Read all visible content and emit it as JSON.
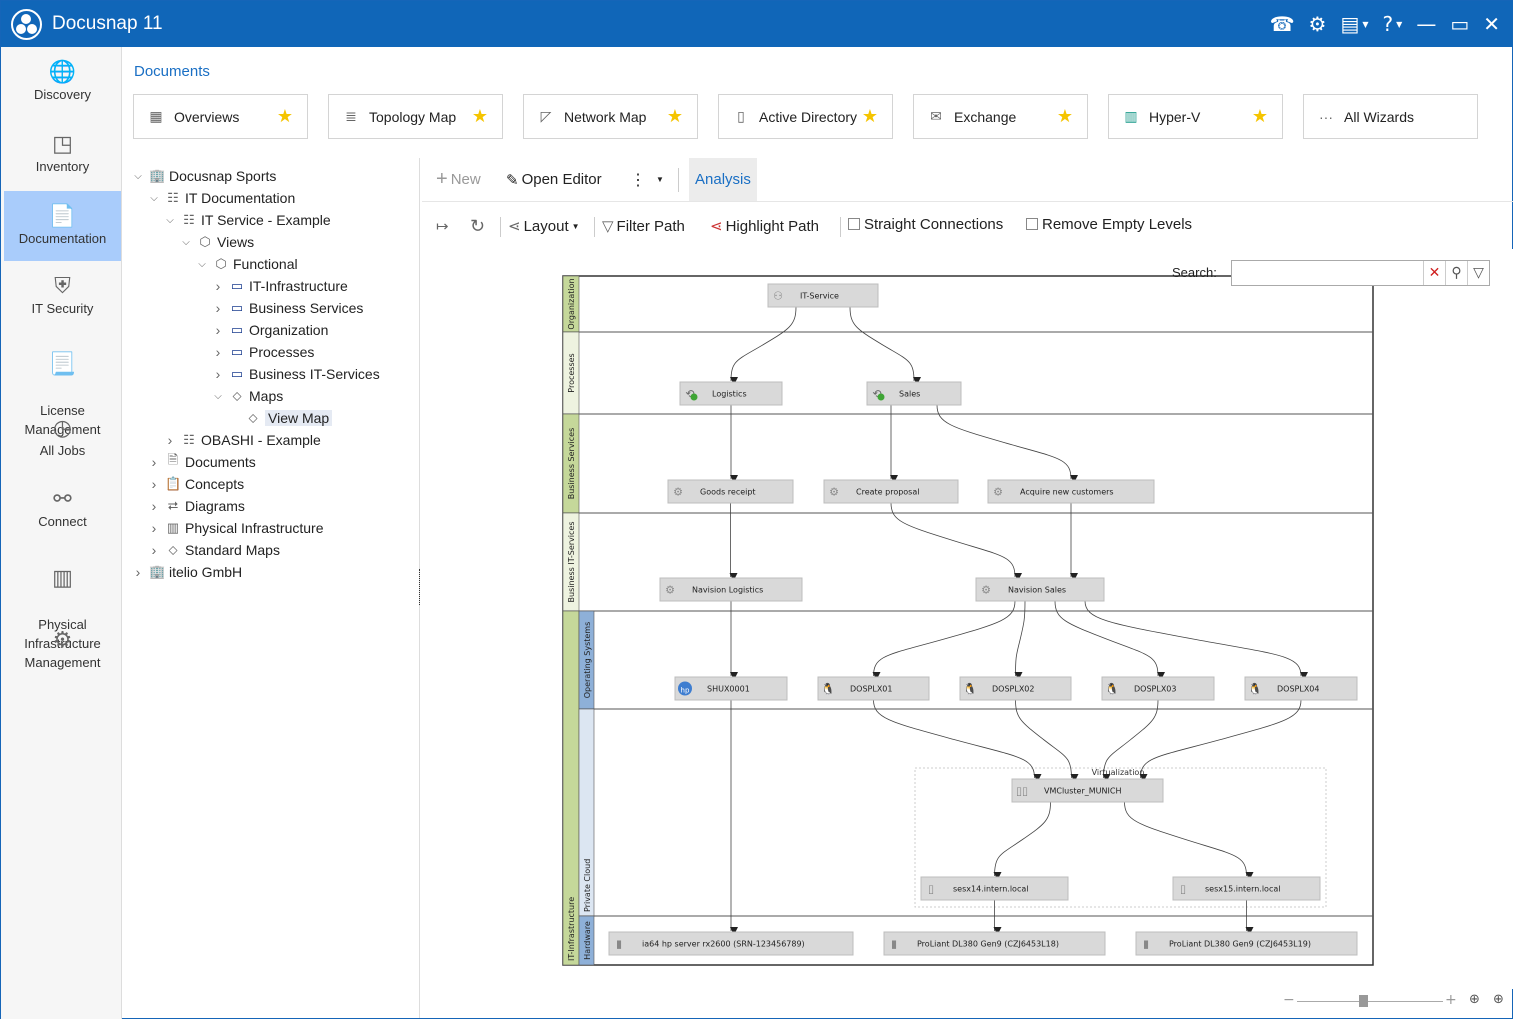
{
  "app": {
    "title": "Docusnap 11",
    "titlebar_icons": [
      {
        "name": "headset-icon",
        "glyph": "☎"
      },
      {
        "name": "gear-icon",
        "glyph": "⚙"
      },
      {
        "name": "workspace-icon",
        "glyph": "▤"
      },
      {
        "name": "help-icon",
        "glyph": "?"
      },
      {
        "name": "minimize-icon",
        "glyph": "—"
      },
      {
        "name": "maximize-icon",
        "glyph": "▭"
      },
      {
        "name": "close-icon",
        "glyph": "✕"
      }
    ]
  },
  "sidebar": {
    "items": [
      {
        "label": "Discovery",
        "icon": "🌐"
      },
      {
        "label": "Inventory",
        "icon": "◳"
      },
      {
        "label": "Documentation",
        "icon": "📄",
        "active": true
      },
      {
        "label": "IT Security",
        "icon": "⛨"
      },
      {
        "label": "License\nManagement",
        "icon": "📃"
      },
      {
        "label": "All Jobs",
        "icon": "◷"
      },
      {
        "label": "Connect",
        "icon": "⚯"
      },
      {
        "label": "Physical\nInfrastructure",
        "icon": "▥"
      },
      {
        "label": "Management",
        "icon": "⚙"
      }
    ]
  },
  "documents": {
    "header": "Documents",
    "wizards": [
      {
        "label": "Overviews",
        "icon": "▦",
        "starred": true
      },
      {
        "label": "Topology Map",
        "icon": "≣",
        "starred": true
      },
      {
        "label": "Network Map",
        "icon": "◸",
        "starred": true
      },
      {
        "label": "Active Directory",
        "icon": "▯",
        "starred": true
      },
      {
        "label": "Exchange",
        "icon": "✉",
        "starred": true
      },
      {
        "label": "Hyper-V",
        "icon": "▥",
        "starred": true
      },
      {
        "label": "All Wizards",
        "icon": "···",
        "starred": false
      }
    ],
    "star": "★"
  },
  "tree": {
    "nodes": [
      {
        "label": "Docusnap Sports",
        "level": 0,
        "expanded": true,
        "icon": "🏢"
      },
      {
        "label": "IT Documentation",
        "level": 1,
        "expanded": true,
        "icon": "☷"
      },
      {
        "label": "IT Service - Example",
        "level": 2,
        "expanded": true,
        "icon": "☷"
      },
      {
        "label": "Views",
        "level": 3,
        "expanded": true,
        "icon": "⬡"
      },
      {
        "label": "Functional",
        "level": 4,
        "expanded": true,
        "icon": "⬡"
      },
      {
        "label": "IT-Infrastructure",
        "level": 5,
        "expanded": false,
        "icon": "▭"
      },
      {
        "label": "Business Services",
        "level": 5,
        "expanded": false,
        "icon": "▭"
      },
      {
        "label": "Organization",
        "level": 5,
        "expanded": false,
        "icon": "▭"
      },
      {
        "label": "Processes",
        "level": 5,
        "expanded": false,
        "icon": "▭"
      },
      {
        "label": "Business IT-Services",
        "level": 5,
        "expanded": false,
        "icon": "▭"
      },
      {
        "label": "Maps",
        "level": 5,
        "expanded": true,
        "icon": "⬦"
      },
      {
        "label": "View Map",
        "level": 6,
        "leaf": true,
        "selected": true,
        "icon": "⬦"
      },
      {
        "label": "OBASHI - Example",
        "level": 2,
        "expanded": false,
        "icon": "☷"
      },
      {
        "label": "Documents",
        "level": 1,
        "expanded": false,
        "icon": "🗎"
      },
      {
        "label": "Concepts",
        "level": 1,
        "expanded": false,
        "icon": "📋"
      },
      {
        "label": "Diagrams",
        "level": 1,
        "expanded": false,
        "icon": "⮂"
      },
      {
        "label": "Physical Infrastructure",
        "level": 1,
        "expanded": false,
        "icon": "▥"
      },
      {
        "label": "Standard Maps",
        "level": 1,
        "expanded": false,
        "icon": "⬦"
      },
      {
        "label": "itelio GmbH",
        "level": 0,
        "expanded": false,
        "icon": "🏢"
      }
    ]
  },
  "toolbar": {
    "new_label": "New",
    "open_editor_label": "Open Editor",
    "analysis_tab": "Analysis",
    "layout_label": "Layout",
    "filter_path_label": "Filter Path",
    "highlight_path_label": "Highlight Path",
    "straight_connections_label": "Straight Connections",
    "straight_connections_checked": false,
    "remove_empty_levels_label": "Remove Empty Levels",
    "remove_empty_levels_checked": false
  },
  "search": {
    "label": "Search:",
    "value": "",
    "placeholder": ""
  },
  "map": {
    "lanes": [
      {
        "label": "Organization",
        "color": "#c5d89a"
      },
      {
        "label": "Processes",
        "color": "#eef3e0"
      },
      {
        "label": "Business Services",
        "color": "#c5d89a"
      },
      {
        "label": "Business IT-Services",
        "color": "#eef3e0"
      }
    ],
    "infra_lane": {
      "label": "IT-Infrastructure",
      "color": "#c5d89a"
    },
    "sub_lanes": [
      {
        "label": "Operating Systems",
        "color": "#8eb0d8"
      },
      {
        "label": "Private Cloud",
        "color": "#dce6f2"
      },
      {
        "label": "Hardware",
        "color": "#8eb0d8"
      }
    ],
    "group_label": "Virtualization",
    "nodes": [
      {
        "id": "itservice",
        "label": "IT-Service",
        "icon": "org"
      },
      {
        "id": "logistics",
        "label": "Logistics",
        "icon": "process"
      },
      {
        "id": "sales",
        "label": "Sales",
        "icon": "process"
      },
      {
        "id": "goods",
        "label": "Goods receipt",
        "icon": "gear"
      },
      {
        "id": "proposal",
        "label": "Create proposal",
        "icon": "gear"
      },
      {
        "id": "acquire",
        "label": "Acquire new customers",
        "icon": "gear"
      },
      {
        "id": "navlog",
        "label": "Navision Logistics",
        "icon": "gear"
      },
      {
        "id": "navsales",
        "label": "Navision Sales",
        "icon": "gear"
      },
      {
        "id": "shux",
        "label": "SHUX0001",
        "icon": "hp"
      },
      {
        "id": "dos1",
        "label": "DOSPLX01",
        "icon": "linux"
      },
      {
        "id": "dos2",
        "label": "DOSPLX02",
        "icon": "linux"
      },
      {
        "id": "dos3",
        "label": "DOSPLX03",
        "icon": "linux"
      },
      {
        "id": "dos4",
        "label": "DOSPLX04",
        "icon": "linux"
      },
      {
        "id": "vmc",
        "label": "VMCluster_MUNICH",
        "icon": "cluster"
      },
      {
        "id": "sesx14",
        "label": "sesx14.intern.local",
        "icon": "host"
      },
      {
        "id": "sesx15",
        "label": "sesx15.intern.local",
        "icon": "host"
      },
      {
        "id": "hw1",
        "label": "ia64 hp server rx2600 (SRN-123456789)",
        "icon": "server"
      },
      {
        "id": "hw2",
        "label": "ProLiant DL380 Gen9 (CZJ6453L18)",
        "icon": "server"
      },
      {
        "id": "hw3",
        "label": "ProLiant DL380 Gen9 (CZJ6453L19)",
        "icon": "server"
      }
    ],
    "edges": [
      [
        "itservice",
        "logistics"
      ],
      [
        "itservice",
        "sales"
      ],
      [
        "logistics",
        "goods"
      ],
      [
        "sales",
        "proposal"
      ],
      [
        "sales",
        "acquire"
      ],
      [
        "goods",
        "navlog"
      ],
      [
        "proposal",
        "navsales"
      ],
      [
        "acquire",
        "navsales"
      ],
      [
        "navlog",
        "shux"
      ],
      [
        "navsales",
        "dos1"
      ],
      [
        "navsales",
        "dos2"
      ],
      [
        "navsales",
        "dos3"
      ],
      [
        "navsales",
        "dos4"
      ],
      [
        "dos1",
        "vmc"
      ],
      [
        "dos2",
        "vmc"
      ],
      [
        "dos3",
        "vmc"
      ],
      [
        "dos4",
        "vmc"
      ],
      [
        "vmc",
        "sesx14"
      ],
      [
        "vmc",
        "sesx15"
      ],
      [
        "shux",
        "hw1"
      ],
      [
        "sesx14",
        "hw2"
      ],
      [
        "sesx15",
        "hw3"
      ]
    ]
  },
  "zoom": {
    "minus": "−",
    "plus": "+",
    "level": 0.45
  }
}
